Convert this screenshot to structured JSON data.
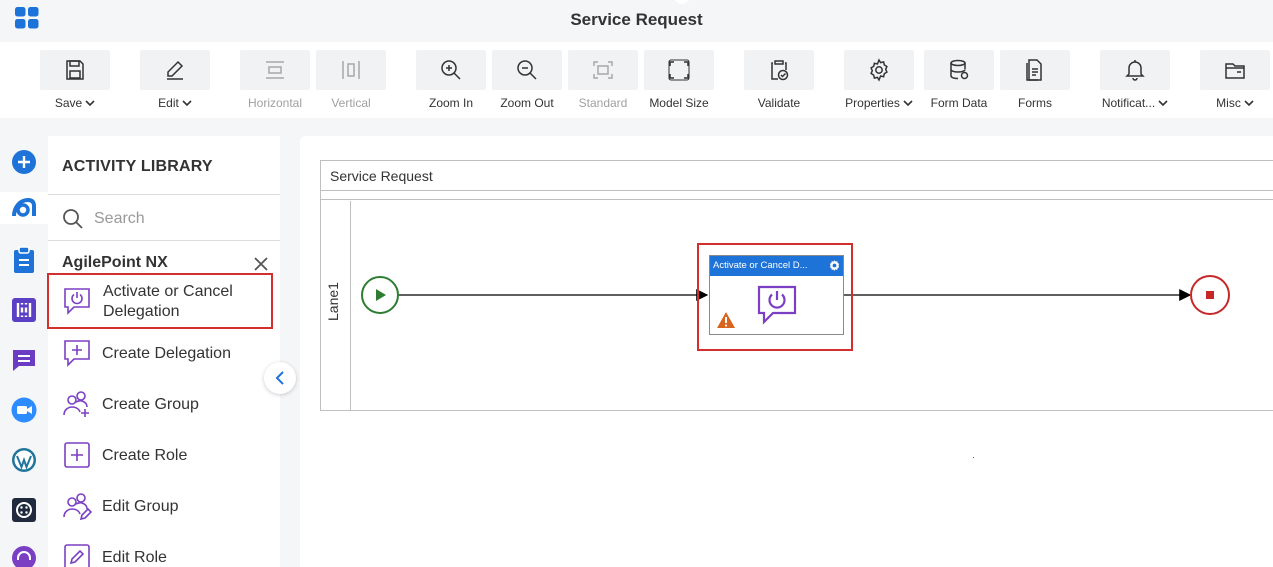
{
  "app": {
    "title": "Service Request"
  },
  "toolbar": {
    "save": "Save",
    "edit": "Edit",
    "horizontal": "Horizontal",
    "vertical": "Vertical",
    "zoom_in": "Zoom In",
    "zoom_out": "Zoom Out",
    "standard": "Standard",
    "model_size": "Model Size",
    "validate": "Validate",
    "properties": "Properties",
    "form_data": "Form Data",
    "forms": "Forms",
    "notifications": "Notificat...",
    "misc": "Misc"
  },
  "rail": {
    "icons": [
      "add-icon",
      "agilepoint-icon",
      "clipboard-icon",
      "integration-icon",
      "chat-icon",
      "video-icon",
      "wordpress-icon",
      "dial-icon",
      "headset-icon"
    ]
  },
  "library": {
    "title": "ACTIVITY LIBRARY",
    "search_placeholder": "Search",
    "group": "AgilePoint NX",
    "activities": [
      {
        "label_1": "Activate or Cancel",
        "label_2": "Delegation"
      },
      {
        "label": "Create Delegation"
      },
      {
        "label": "Create Group"
      },
      {
        "label": "Create Role"
      },
      {
        "label": "Edit Group"
      },
      {
        "label": "Edit Role"
      }
    ]
  },
  "canvas": {
    "pool_title": "Service Request",
    "lane_label": "Lane1",
    "task_title": "Activate or Cancel D..."
  },
  "colors": {
    "accent_blue": "#1e73d8",
    "highlight_red": "#d32f2f",
    "start_green": "#2e7d32",
    "end_red": "#c62828",
    "activity_purple": "#7b3fc4"
  }
}
